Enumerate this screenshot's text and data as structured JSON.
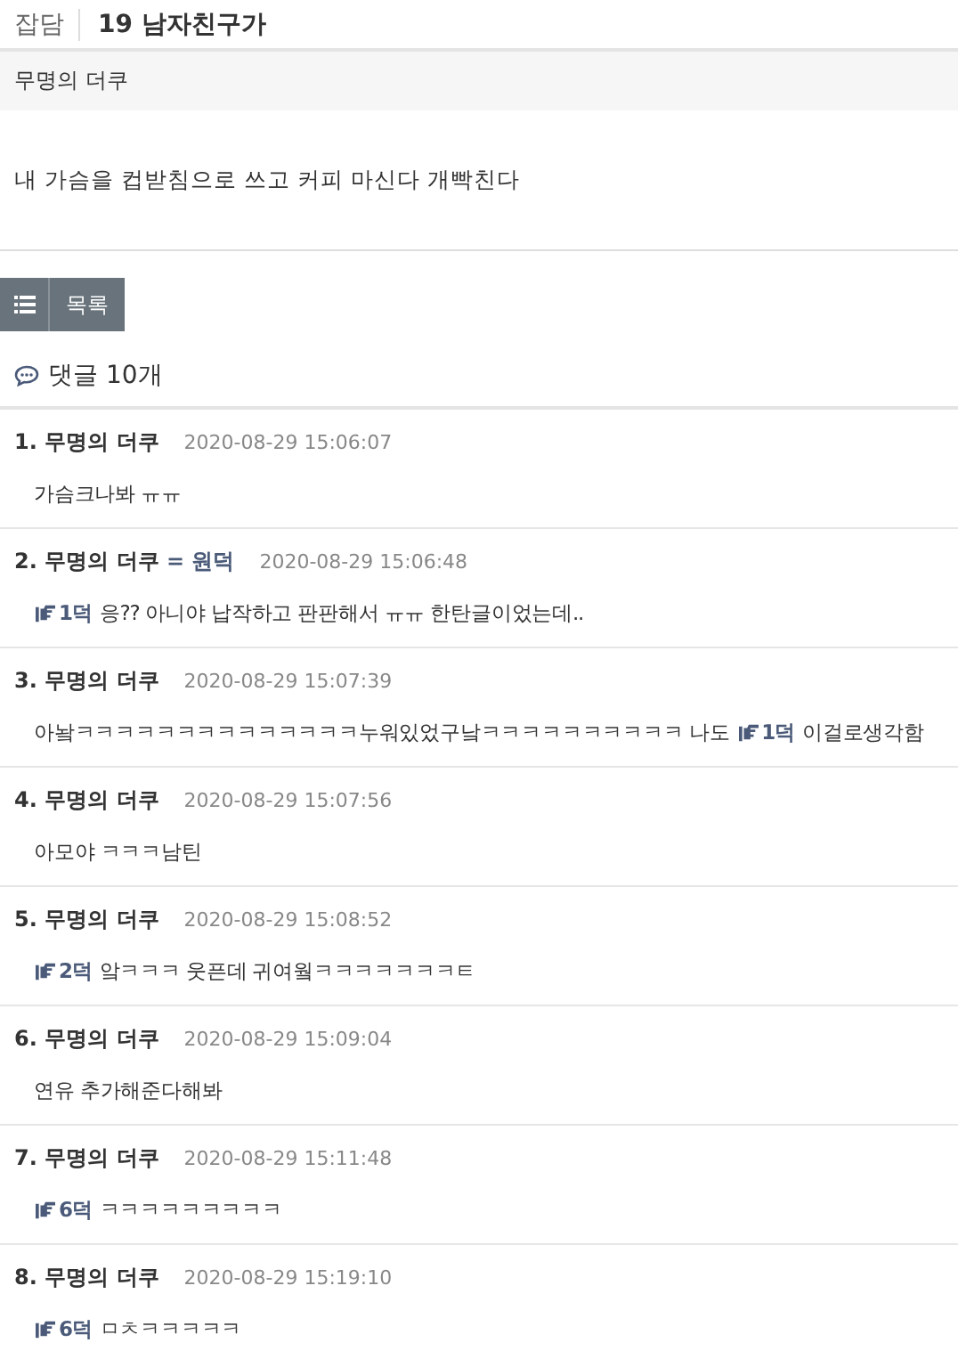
{
  "header": {
    "category": "잡담",
    "title": "19 남자친구가"
  },
  "post": {
    "author": "무명의 더쿠",
    "body": "내 가슴을 컵받침으로 쓰고 커피 마신다 개빡친다"
  },
  "list_button": {
    "label": "목록"
  },
  "comments_heading": "댓글 10개",
  "comments": [
    {
      "number": "1.",
      "author": "무명의 더쿠",
      "time": "2020-08-29 15:06:07",
      "body": [
        {
          "kind": "text",
          "text": "가슴크나봐 ㅠㅠ"
        }
      ]
    },
    {
      "number": "2.",
      "author": "무명의 더쿠",
      "op_mark": "= 원덕",
      "time": "2020-08-29 15:06:48",
      "body": [
        {
          "kind": "ref",
          "text": "1덕"
        },
        {
          "kind": "text",
          "text": "응?? 아니야 납작하고 판판해서 ㅠㅠ 한탄글이었는데.."
        }
      ]
    },
    {
      "number": "3.",
      "author": "무명의 더쿠",
      "time": "2020-08-29 15:07:39",
      "body": [
        {
          "kind": "text",
          "text": "아놬ㅋㅋㅋㅋㅋㅋㅋㅋㅋㅋㅋㅋㅋㅋ누워있었구낰ㅋㅋㅋㅋㅋㅋㅋㅋㅋㅋ 나도"
        },
        {
          "kind": "ref",
          "text": "1덕"
        },
        {
          "kind": "text",
          "text": "이걸로생각함"
        }
      ]
    },
    {
      "number": "4.",
      "author": "무명의 더쿠",
      "time": "2020-08-29 15:07:56",
      "body": [
        {
          "kind": "text",
          "text": "아모야 ㅋㅋㅋ남틴"
        }
      ]
    },
    {
      "number": "5.",
      "author": "무명의 더쿠",
      "time": "2020-08-29 15:08:52",
      "body": [
        {
          "kind": "ref",
          "text": "2덕"
        },
        {
          "kind": "text",
          "text": "앜ㅋㅋㅋ 웃픈데 귀여웤ㅋㅋㅋㅋㅋㅋㅋㅌ"
        }
      ]
    },
    {
      "number": "6.",
      "author": "무명의 더쿠",
      "time": "2020-08-29 15:09:04",
      "body": [
        {
          "kind": "text",
          "text": "연유 추가해준다해봐"
        }
      ]
    },
    {
      "number": "7.",
      "author": "무명의 더쿠",
      "time": "2020-08-29 15:11:48",
      "body": [
        {
          "kind": "ref",
          "text": "6덕"
        },
        {
          "kind": "text",
          "text": "ㅋㅋㅋㅋㅋㅋㅋㅋㅋ"
        }
      ]
    },
    {
      "number": "8.",
      "author": "무명의 더쿠",
      "time": "2020-08-29 15:19:10",
      "body": [
        {
          "kind": "ref",
          "text": "6덕"
        },
        {
          "kind": "text",
          "text": "ㅁㅊㅋㅋㅋㅋㅋ"
        }
      ]
    }
  ]
}
